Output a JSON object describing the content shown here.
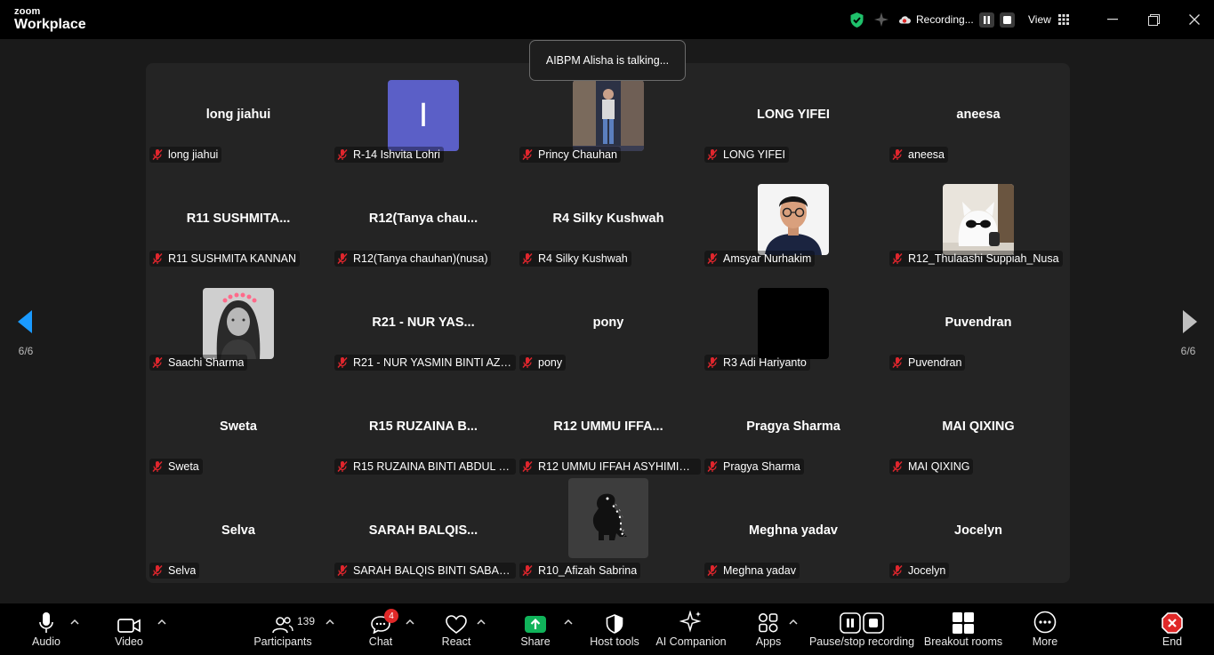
{
  "app": {
    "brand_top": "zoom",
    "brand_bottom": "Workplace"
  },
  "recording": {
    "status": "Recording..."
  },
  "view": {
    "label": "View"
  },
  "toast": {
    "text": "AIBPM Alisha is talking..."
  },
  "pagination": {
    "left": "6/6",
    "right": "6/6"
  },
  "tiles": [
    {
      "name": "long jiahui",
      "label": "long jiahui"
    },
    {
      "name": "",
      "label": "R-14 Ishvita Lohri",
      "avatar": "letter",
      "letter": "I"
    },
    {
      "name": "",
      "label": "Princy Chauhan",
      "avatar": "photo-person-doorway"
    },
    {
      "name": "LONG YIFEI",
      "label": "LONG YIFEI"
    },
    {
      "name": "aneesa",
      "label": "aneesa"
    },
    {
      "name": "R11  SUSHMITA...",
      "label": "R11 SUSHMITA KANNAN"
    },
    {
      "name": "R12(Tanya  chau...",
      "label": "R12(Tanya chauhan)(nusa)"
    },
    {
      "name": "R4 Silky Kushwah",
      "label": "R4 Silky Kushwah"
    },
    {
      "name": "",
      "label": "Amsyar Nurhakim",
      "avatar": "photo-man-glasses"
    },
    {
      "name": "",
      "label": "R12_Thulaashi Suppiah_Nusa",
      "avatar": "photo-white-cat-toy"
    },
    {
      "name": "",
      "label": "Saachi Sharma",
      "avatar": "photo-woman-bw"
    },
    {
      "name": "R21 - NUR YAS...",
      "label": "R21 - NUR YASMIN BINTI AZA..."
    },
    {
      "name": "pony",
      "label": "pony"
    },
    {
      "name": "",
      "label": "R3 Adi Hariyanto",
      "avatar": "black"
    },
    {
      "name": "Puvendran",
      "label": "Puvendran"
    },
    {
      "name": "Sweta",
      "label": "Sweta"
    },
    {
      "name": "R15 RUZAINA B...",
      "label": "R15 RUZAINA BINTI ABDUL R..."
    },
    {
      "name": "R12  UMMU  IFFA...",
      "label": "R12 UMMU IFFAH ASYHIMIE B..."
    },
    {
      "name": "Pragya Sharma",
      "label": "Pragya Sharma"
    },
    {
      "name": "MAI QIXING",
      "label": "MAI QIXING"
    },
    {
      "name": "Selva",
      "label": "Selva"
    },
    {
      "name": "SARAH  BALQIS...",
      "label": "SARAH BALQIS BINTI SABARU..."
    },
    {
      "name": "",
      "label": "R10_Afizah Sabrina",
      "avatar": "dinosaur"
    },
    {
      "name": "Meghna yadav",
      "label": "Meghna yadav"
    },
    {
      "name": "Jocelyn",
      "label": "Jocelyn"
    }
  ],
  "toolbar": {
    "audio": "Audio",
    "video": "Video",
    "participants": "Participants",
    "participants_count": "139",
    "chat": "Chat",
    "chat_badge": "4",
    "react": "React",
    "share": "Share",
    "host_tools": "Host tools",
    "ai_companion": "AI Companion",
    "apps": "Apps",
    "pause_recording": "Pause/stop recording",
    "breakout_rooms": "Breakout rooms",
    "more": "More",
    "end": "End"
  },
  "colors": {
    "accent_green": "#1fc16b",
    "share_green": "#10b35a",
    "end_red": "#e02828",
    "mute_red": "#e0262d",
    "letter_avatar": "#5b5fc7"
  }
}
